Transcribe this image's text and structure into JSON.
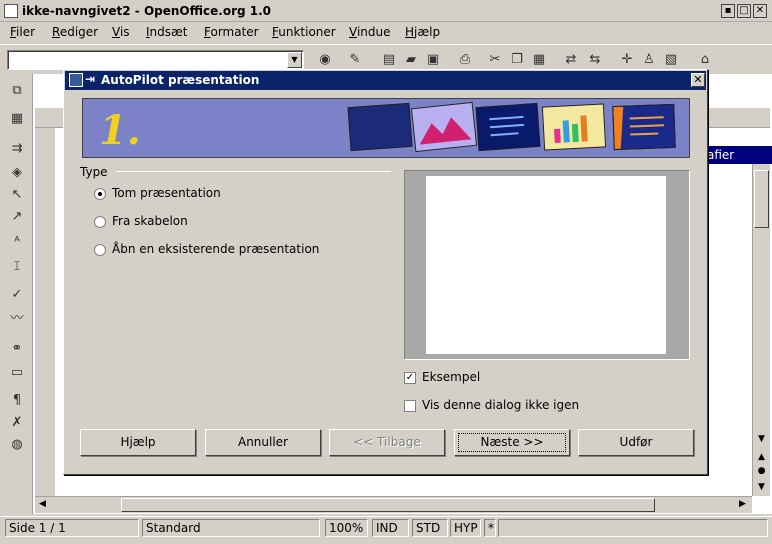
{
  "window": {
    "title": "ikke-navngivet2 - OpenOffice.org 1.0",
    "min": "▪",
    "max": "□",
    "close": "✕"
  },
  "menu": [
    "Filer",
    "Rediger",
    "Vis",
    "Indsæt",
    "Formater",
    "Funktioner",
    "Vindue",
    "Hjælp"
  ],
  "toolbar": {
    "style_combo_value": ""
  },
  "navigator_strip": "afier",
  "dialog": {
    "title": "AutoPilot præsentation",
    "step_number": "1.",
    "type_group_label": "Type",
    "options": [
      {
        "label": "Tom præsentation",
        "selected": true
      },
      {
        "label": "Fra skabelon",
        "selected": false
      },
      {
        "label": "Åbn en eksisterende præsentation",
        "selected": false
      }
    ],
    "checks": [
      {
        "label": "Eksempel",
        "checked": true
      },
      {
        "label": "Vis denne dialog ikke igen",
        "checked": false
      }
    ],
    "buttons": {
      "help": "Hjælp",
      "cancel": "Annuller",
      "back": "<< Tilbage",
      "next": "Næste >>",
      "finish": "Udfør"
    },
    "banner_color": "#7b82c8",
    "title_color": "#0a246a"
  },
  "status": {
    "page": "Side 1 / 1",
    "style": "Standard",
    "zoom": "100%",
    "ind": "IND",
    "std": "STD",
    "hyp": "HYP",
    "mod": "*"
  }
}
